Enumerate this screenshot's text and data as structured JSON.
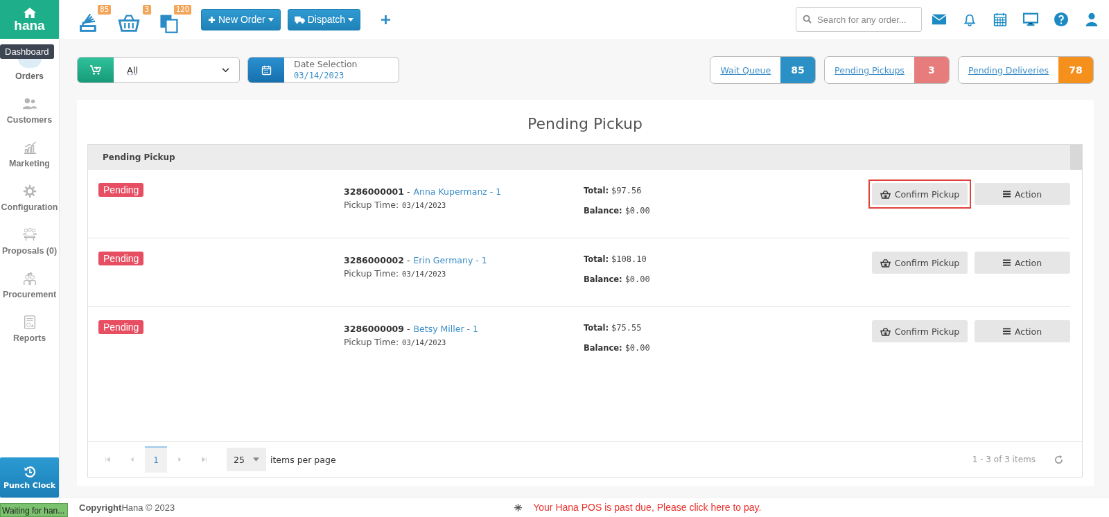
{
  "sidebar": {
    "logo": "hana",
    "tooltip": "Dashboard",
    "items": [
      {
        "label": "Orders",
        "selected": true
      },
      {
        "label": "Customers",
        "selected": false
      },
      {
        "label": "Marketing",
        "selected": false
      },
      {
        "label": "Configuration",
        "selected": false
      },
      {
        "label": "Proposals (0)",
        "selected": false
      },
      {
        "label": "Procurement",
        "selected": false
      },
      {
        "label": "Reports",
        "selected": false
      }
    ],
    "punch_clock": "Punch Clock"
  },
  "header": {
    "counters": [
      {
        "count": "85"
      },
      {
        "count": "3"
      },
      {
        "count": "120"
      }
    ],
    "buttons": [
      {
        "label": "New Order"
      },
      {
        "label": "Dispatch"
      }
    ],
    "search": {
      "placeholder": "Search for any order..."
    }
  },
  "filters": {
    "store": {
      "value": "All"
    },
    "date": {
      "label": "Date Selection",
      "value": "03/14/2023"
    }
  },
  "stats": [
    {
      "label": "Wait Queue",
      "count": "85",
      "color": "#2b90c5"
    },
    {
      "label": "Pending Pickups",
      "count": "3",
      "color": "#e77c7c"
    },
    {
      "label": "Pending Deliveries",
      "count": "78",
      "color": "#f5901c"
    }
  ],
  "panel": {
    "title": "Pending Pickup",
    "grid_header": "Pending Pickup",
    "rows": [
      {
        "status": "Pending",
        "order": "**3286000001** -",
        "customer": "Anna Kupermanz - 1",
        "pickup_label": "Pickup Time:",
        "pickup_time": "03/14/2023",
        "total_label": "Total:",
        "total": "$97.56",
        "balance_label": "Balance:",
        "balance": "$0.00",
        "confirm": "Confirm Pickup",
        "action": "Action",
        "highlighted": true
      },
      {
        "status": "Pending",
        "order": "**3286000002** -",
        "customer": "Erin Germany - 1",
        "pickup_label": "Pickup Time:",
        "pickup_time": "03/14/2023",
        "total_label": "Total:",
        "total": "$108.10",
        "balance_label": "Balance:",
        "balance": "$0.00",
        "confirm": "Confirm Pickup",
        "action": "Action",
        "highlighted": false
      },
      {
        "status": "Pending",
        "order": "**3286000009** -",
        "customer": "Betsy Miller - 1",
        "pickup_label": "Pickup Time:",
        "pickup_time": "03/14/2023",
        "total_label": "Total:",
        "total": "$75.55",
        "balance_label": "Balance:",
        "balance": "$0.00",
        "confirm": "Confirm Pickup",
        "action": "Action",
        "highlighted": false
      }
    ],
    "pager": {
      "pages": [
        {
          "label": "1",
          "selected": true
        }
      ],
      "page_size": "25",
      "page_size_label": "items per page",
      "summary": "1 - 3 of 3 items"
    }
  },
  "footer": {
    "copyright": "**Copyright**Hana © 2023",
    "notice": "Your Hana POS is past due, Please click here to pay."
  },
  "status": "Waiting for han..."
}
